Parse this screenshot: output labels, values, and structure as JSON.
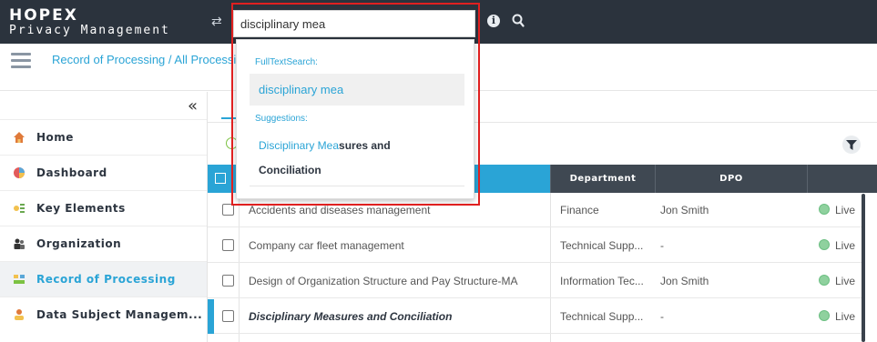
{
  "header": {
    "logo_main": "HOPEX",
    "logo_sub": "Privacy Management",
    "search_value": "disciplinary mea",
    "swap_icon": "swap-arrows-icon",
    "info_icon": "info-icon",
    "search_icon": "search-icon"
  },
  "breadcrumb": {
    "text": "Record of Processing / All Processing"
  },
  "sidebar": {
    "collapse_glyph": "«",
    "items": [
      {
        "label": "Home",
        "icon": "home-icon"
      },
      {
        "label": "Dashboard",
        "icon": "dashboard-icon"
      },
      {
        "label": "Key Elements",
        "icon": "key-elements-icon"
      },
      {
        "label": "Organization",
        "icon": "organization-icon"
      },
      {
        "label": "Record of Processing",
        "icon": "record-icon",
        "active": true
      },
      {
        "label": "Data Subject Managem...",
        "icon": "data-subject-icon"
      }
    ]
  },
  "table": {
    "headers": {
      "department": "Department",
      "dpo": "DPO"
    },
    "rows": [
      {
        "name": "Accidents and diseases management",
        "department": "Finance",
        "dpo": "Jon Smith",
        "status": "Live"
      },
      {
        "name": "Company car fleet management",
        "department": "Technical Supp...",
        "dpo": "-",
        "status": "Live"
      },
      {
        "name": "Design of Organization Structure and Pay Structure-MA",
        "department": "Information Tec...",
        "dpo": "Jon Smith",
        "status": "Live"
      },
      {
        "name": "Disciplinary Measures and Conciliation",
        "department": "Technical Supp...",
        "dpo": "-",
        "status": "Live",
        "selected": true
      }
    ]
  },
  "dropdown": {
    "fulltext_label": "FullTextSearch:",
    "fulltext_item": "disciplinary mea",
    "suggestions_label": "Suggestions:",
    "suggestion_highlight": "Disciplinary Mea",
    "suggestion_rest_line1": "sures and",
    "suggestion_line2": "Conciliation"
  },
  "colors": {
    "topbar": "#2b333d",
    "accent": "#2aa4d6",
    "live": "#8fd19e",
    "highlight_frame": "#e02020"
  }
}
